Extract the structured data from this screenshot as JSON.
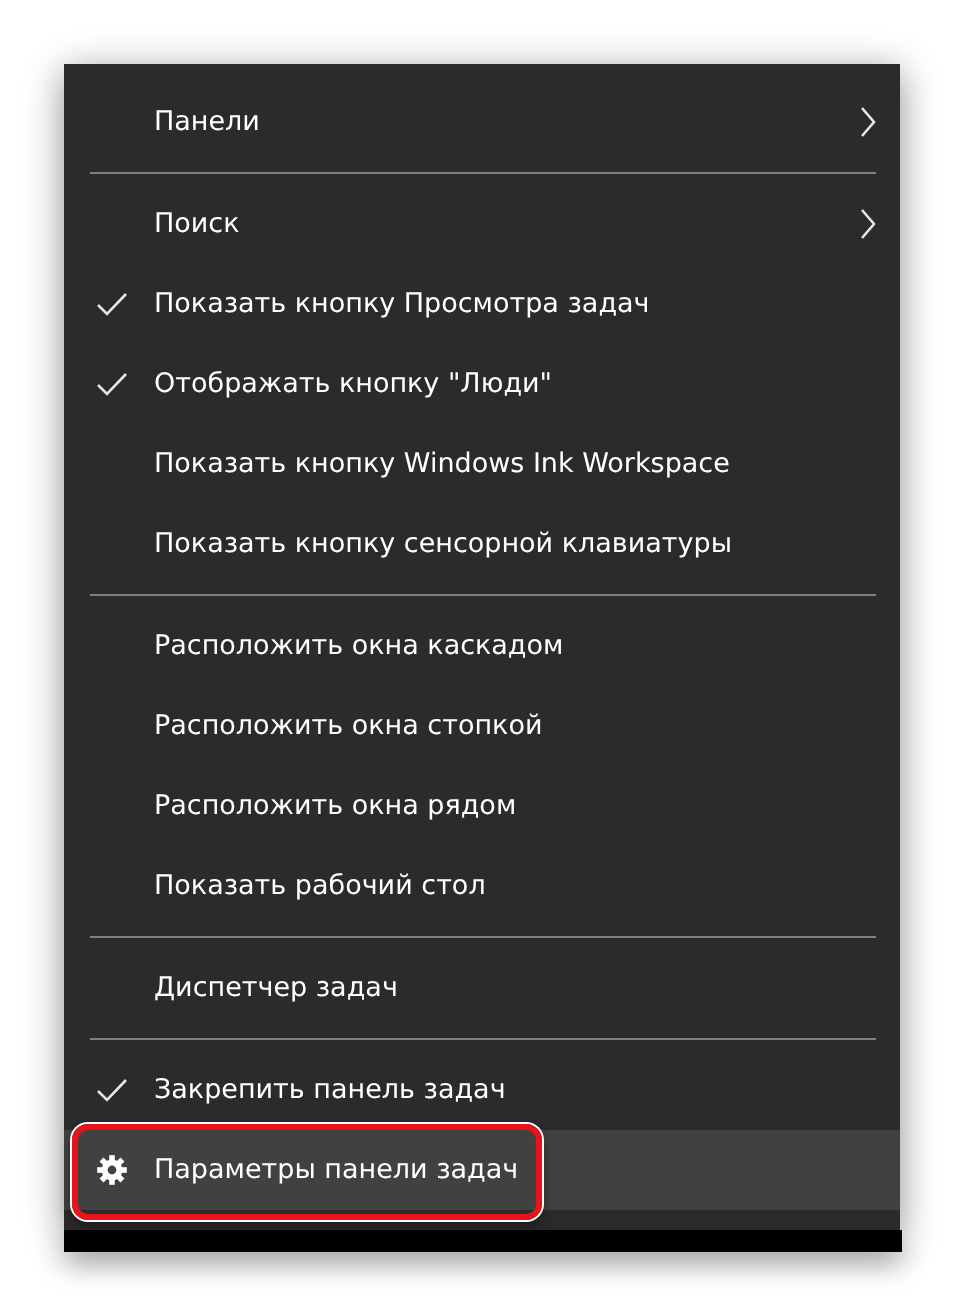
{
  "menu": {
    "items": [
      {
        "kind": "submenu",
        "label": "Панели",
        "checked": false,
        "selected": false
      },
      {
        "kind": "separator"
      },
      {
        "kind": "submenu",
        "label": "Поиск",
        "checked": false,
        "selected": false
      },
      {
        "kind": "item",
        "label": "Показать кнопку Просмотра задач",
        "checked": true,
        "selected": false
      },
      {
        "kind": "item",
        "label": "Отображать кнопку \"Люди\"",
        "checked": true,
        "selected": false
      },
      {
        "kind": "item",
        "label": "Показать кнопку Windows Ink Workspace",
        "checked": false,
        "selected": false
      },
      {
        "kind": "item",
        "label": "Показать кнопку сенсорной клавиатуры",
        "checked": false,
        "selected": false
      },
      {
        "kind": "separator"
      },
      {
        "kind": "item",
        "label": "Расположить окна каскадом",
        "checked": false,
        "selected": false
      },
      {
        "kind": "item",
        "label": "Расположить окна стопкой",
        "checked": false,
        "selected": false
      },
      {
        "kind": "item",
        "label": "Расположить окна рядом",
        "checked": false,
        "selected": false
      },
      {
        "kind": "item",
        "label": "Показать рабочий стол",
        "checked": false,
        "selected": false
      },
      {
        "kind": "separator"
      },
      {
        "kind": "item",
        "label": "Диспетчер задач",
        "checked": false,
        "selected": false
      },
      {
        "kind": "separator"
      },
      {
        "kind": "item",
        "label": "Закрепить панель задач",
        "checked": true,
        "selected": false
      },
      {
        "kind": "settings",
        "label": "Параметры панели задач",
        "selected": true,
        "annotated": true
      }
    ]
  }
}
